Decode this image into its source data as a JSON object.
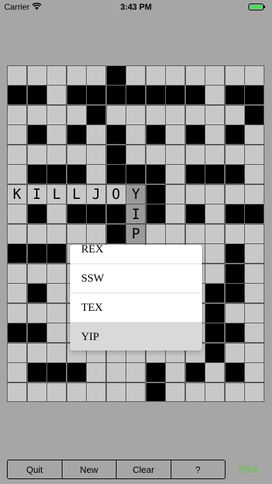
{
  "status": {
    "carrier": "Carrier",
    "time": "3:43 PM"
  },
  "grid": {
    "rows": 17,
    "cols": 13,
    "black_cells": [
      [
        0,
        5
      ],
      [
        1,
        0
      ],
      [
        1,
        1
      ],
      [
        1,
        3
      ],
      [
        1,
        4
      ],
      [
        1,
        5
      ],
      [
        1,
        6
      ],
      [
        1,
        7
      ],
      [
        1,
        8
      ],
      [
        1,
        9
      ],
      [
        1,
        11
      ],
      [
        1,
        12
      ],
      [
        2,
        4
      ],
      [
        2,
        12
      ],
      [
        3,
        1
      ],
      [
        3,
        3
      ],
      [
        3,
        5
      ],
      [
        3,
        7
      ],
      [
        3,
        9
      ],
      [
        3,
        11
      ],
      [
        4,
        5
      ],
      [
        5,
        1
      ],
      [
        5,
        2
      ],
      [
        5,
        3
      ],
      [
        5,
        5
      ],
      [
        5,
        6
      ],
      [
        5,
        7
      ],
      [
        5,
        9
      ],
      [
        5,
        10
      ],
      [
        5,
        11
      ],
      [
        6,
        7
      ],
      [
        7,
        1
      ],
      [
        7,
        3
      ],
      [
        7,
        4
      ],
      [
        7,
        5
      ],
      [
        7,
        7
      ],
      [
        7,
        9
      ],
      [
        7,
        11
      ],
      [
        7,
        12
      ],
      [
        8,
        5
      ],
      [
        9,
        0
      ],
      [
        9,
        1
      ],
      [
        9,
        2
      ],
      [
        9,
        11
      ],
      [
        10,
        11
      ],
      [
        11,
        1
      ],
      [
        11,
        10
      ],
      [
        11,
        11
      ],
      [
        12,
        10
      ],
      [
        13,
        0
      ],
      [
        13,
        1
      ],
      [
        13,
        10
      ],
      [
        13,
        11
      ],
      [
        14,
        10
      ],
      [
        15,
        1
      ],
      [
        15,
        2
      ],
      [
        15,
        3
      ],
      [
        15,
        7
      ],
      [
        15,
        9
      ],
      [
        15,
        11
      ],
      [
        16,
        7
      ]
    ],
    "letters": [
      {
        "row": 6,
        "col": 0,
        "char": "K"
      },
      {
        "row": 6,
        "col": 1,
        "char": "I"
      },
      {
        "row": 6,
        "col": 2,
        "char": "L"
      },
      {
        "row": 6,
        "col": 3,
        "char": "L"
      },
      {
        "row": 6,
        "col": 4,
        "char": "J"
      },
      {
        "row": 6,
        "col": 5,
        "char": "O"
      },
      {
        "row": 6,
        "col": 6,
        "char": "Y"
      },
      {
        "row": 7,
        "col": 6,
        "char": "I"
      },
      {
        "row": 8,
        "col": 6,
        "char": "P"
      }
    ],
    "active_cells": [
      [
        6,
        6
      ],
      [
        7,
        6
      ],
      [
        8,
        6
      ]
    ]
  },
  "picker": {
    "options": [
      "REX",
      "SSW",
      "TEX",
      "YIP"
    ],
    "selected": "YIP"
  },
  "toolbar": {
    "quit": "Quit",
    "new": "New",
    "clear": "Clear",
    "help": "?"
  },
  "pick_label": "Pick",
  "colors": {
    "pick": "#5ec83a",
    "background": "#a6a6a6",
    "cell": "#c8c8c8"
  }
}
